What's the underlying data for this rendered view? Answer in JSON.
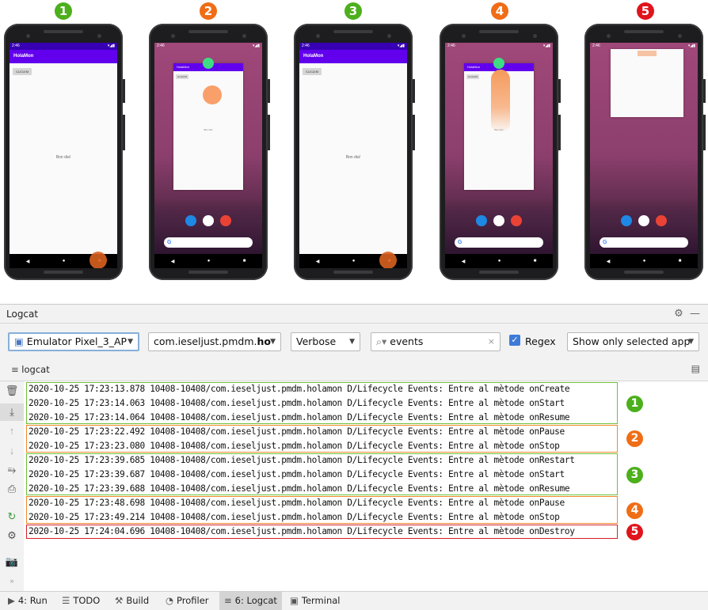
{
  "steps": [
    {
      "num": "1",
      "color": "#4caf1c"
    },
    {
      "num": "2",
      "color": "#f06d16"
    },
    {
      "num": "3",
      "color": "#4caf1c"
    },
    {
      "num": "4",
      "color": "#f06d16"
    },
    {
      "num": "5",
      "color": "#e0141c"
    }
  ],
  "phone_app": {
    "status_time": "2:46",
    "app_title": "HolaMon",
    "button_label": "CLICA'M",
    "center_text": "Bon dia!",
    "search_logo": "G"
  },
  "logcat": {
    "title": "Logcat",
    "device": "Emulator Pixel_3_AP",
    "package_prefix": "com.ieseljust.pmdm.",
    "package_bold": "ho",
    "level": "Verbose",
    "search_value": "events",
    "regex_label": "Regex",
    "regex_checked": true,
    "filter": "Show only selected app",
    "subtab_label": "logcat",
    "lines": [
      "2020-10-25 17:23:13.878 10408-10408/com.ieseljust.pmdm.holamon D/Lifecycle Events: Entre al mètode onCreate",
      "2020-10-25 17:23:14.063 10408-10408/com.ieseljust.pmdm.holamon D/Lifecycle Events: Entre al mètode onStart",
      "2020-10-25 17:23:14.064 10408-10408/com.ieseljust.pmdm.holamon D/Lifecycle Events: Entre al mètode onResume",
      "2020-10-25 17:23:22.492 10408-10408/com.ieseljust.pmdm.holamon D/Lifecycle Events: Entre al mètode onPause",
      "2020-10-25 17:23:23.080 10408-10408/com.ieseljust.pmdm.holamon D/Lifecycle Events: Entre al mètode onStop",
      "2020-10-25 17:23:39.685 10408-10408/com.ieseljust.pmdm.holamon D/Lifecycle Events: Entre al mètode onRestart",
      "2020-10-25 17:23:39.687 10408-10408/com.ieseljust.pmdm.holamon D/Lifecycle Events: Entre al mètode onStart",
      "2020-10-25 17:23:39.688 10408-10408/com.ieseljust.pmdm.holamon D/Lifecycle Events: Entre al mètode onResume",
      "2020-10-25 17:23:48.698 10408-10408/com.ieseljust.pmdm.holamon D/Lifecycle Events: Entre al mètode onPause",
      "2020-10-25 17:23:49.214 10408-10408/com.ieseljust.pmdm.holamon D/Lifecycle Events: Entre al mètode onStop",
      "2020-10-25 17:24:04.696 10408-10408/com.ieseljust.pmdm.holamon D/Lifecycle Events: Entre al mètode onDestroy"
    ]
  },
  "bottom_tabs": [
    {
      "label": "4: Run",
      "icon": "run-icon"
    },
    {
      "label": "TODO",
      "icon": "todo-icon"
    },
    {
      "label": "Build",
      "icon": "build-icon"
    },
    {
      "label": "Profiler",
      "icon": "profiler-icon"
    },
    {
      "label": "6: Logcat",
      "icon": "logcat-icon",
      "active": true
    },
    {
      "label": "Terminal",
      "icon": "terminal-icon"
    }
  ]
}
